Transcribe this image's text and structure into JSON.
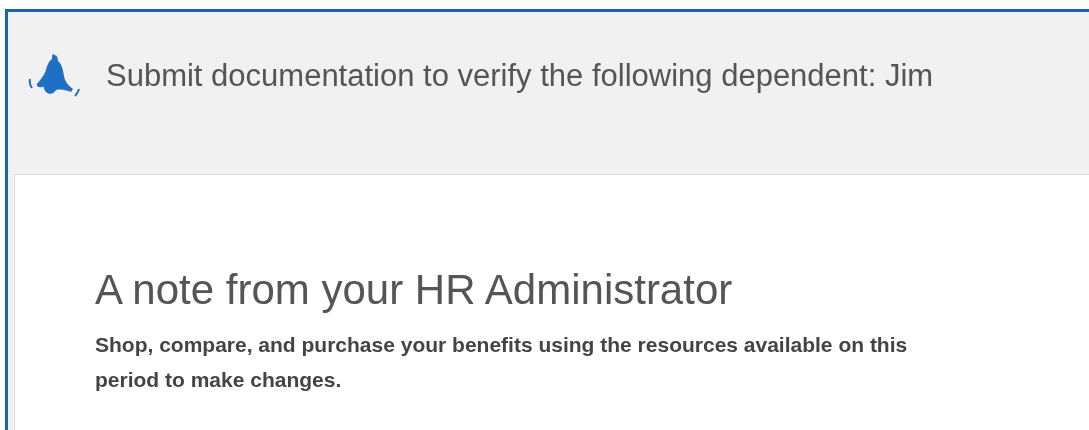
{
  "banner": {
    "text": "Submit documentation to verify the following dependent: Jim"
  },
  "note": {
    "title": "A note from your HR Administrator",
    "lines": [
      "Shop, compare, and purchase your benefits using the resources available on this",
      "period to make changes."
    ]
  }
}
